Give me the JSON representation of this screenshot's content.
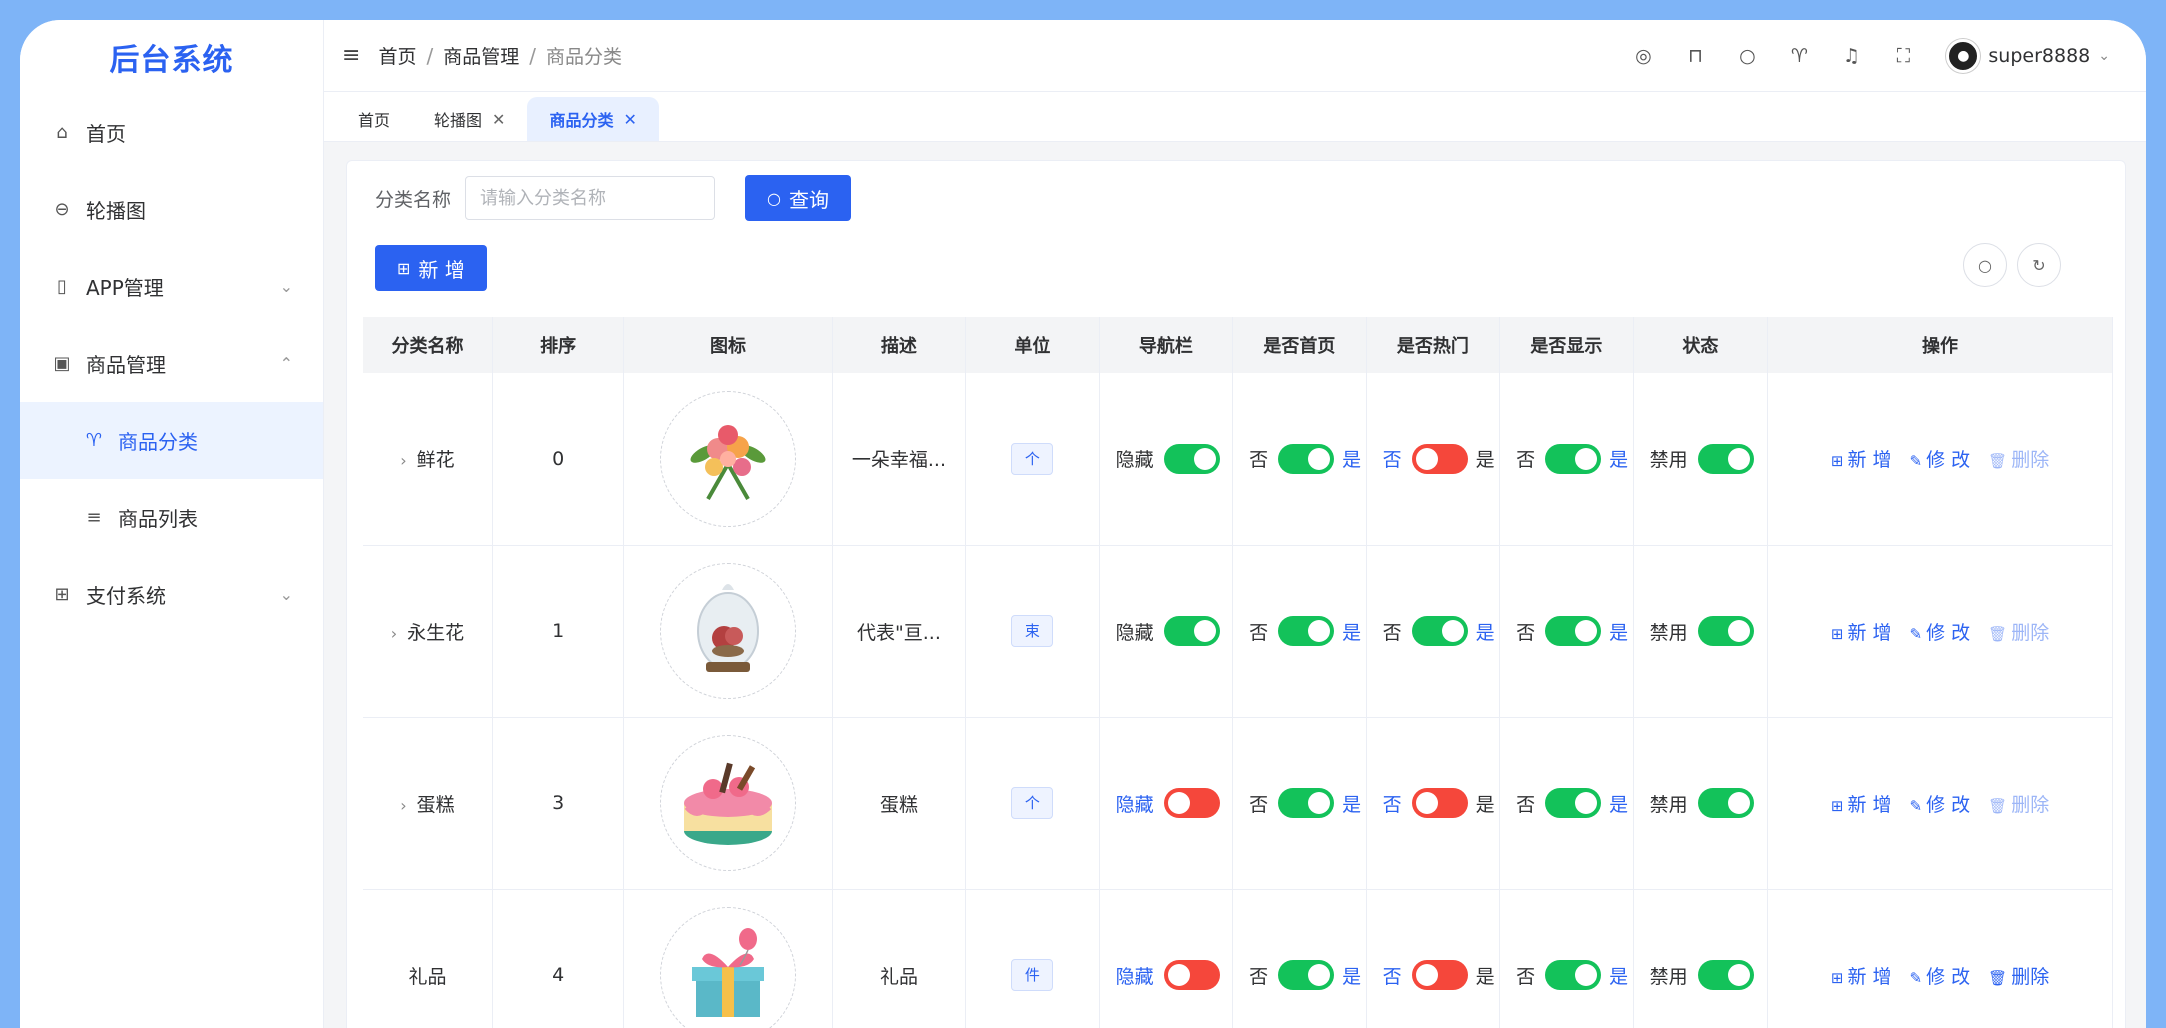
{
  "sidebar": {
    "logo": "后台系统",
    "items": [
      {
        "label": "首页",
        "icon": "home-icon"
      },
      {
        "label": "轮播图",
        "icon": "carousel-icon"
      },
      {
        "label": "APP管理",
        "icon": "phone-icon"
      },
      {
        "label": "商品管理",
        "icon": "product-icon"
      },
      {
        "label": "商品分类",
        "icon": "tshirt-icon"
      },
      {
        "label": "商品列表",
        "icon": "list-icon"
      },
      {
        "label": "支付系统",
        "icon": "payment-icon"
      }
    ]
  },
  "header": {
    "breadcrumb": [
      "首页",
      "商品管理",
      "商品分类"
    ],
    "username": "super8888"
  },
  "tabs": [
    {
      "label": "首页"
    },
    {
      "label": "轮播图"
    },
    {
      "label": "商品分类"
    }
  ],
  "search": {
    "label": "分类名称",
    "placeholder": "请输入分类名称",
    "button": "查询"
  },
  "toolbar": {
    "add_label": "新 增"
  },
  "table": {
    "columns": [
      "分类名称",
      "排序",
      "图标",
      "描述",
      "单位",
      "导航栏",
      "是否首页",
      "是否热门",
      "是否显示",
      "状态",
      "操作"
    ],
    "rows": [
      {
        "name": "鲜花",
        "sort": "0",
        "desc": "一朵幸福...",
        "unit": "个",
        "expandable": true,
        "nav": {
          "text": "隐藏",
          "on": true
        },
        "home": {
          "on": true
        },
        "hot": {
          "on": false
        },
        "show": {
          "on": true
        },
        "status": {
          "text": "禁用",
          "on": true
        }
      },
      {
        "name": "永生花",
        "sort": "1",
        "desc": "代表\"亘...",
        "unit": "束",
        "expandable": true,
        "nav": {
          "text": "隐藏",
          "on": true
        },
        "home": {
          "on": true
        },
        "hot": {
          "on": true
        },
        "show": {
          "on": true
        },
        "status": {
          "text": "禁用",
          "on": true
        }
      },
      {
        "name": "蛋糕",
        "sort": "3",
        "desc": "蛋糕",
        "unit": "个",
        "expandable": true,
        "nav": {
          "text": "隐藏",
          "on": false
        },
        "home": {
          "on": true
        },
        "hot": {
          "on": false
        },
        "show": {
          "on": true
        },
        "status": {
          "text": "禁用",
          "on": true
        }
      },
      {
        "name": "礼品",
        "sort": "4",
        "desc": "礼品",
        "unit": "件",
        "expandable": false,
        "nav": {
          "text": "隐藏",
          "on": false
        },
        "home": {
          "on": true
        },
        "hot": {
          "on": false
        },
        "show": {
          "on": true
        },
        "status": {
          "text": "禁用",
          "on": true
        }
      }
    ],
    "switch_off_text": "否",
    "switch_on_text": "是",
    "ops": {
      "add": "新 增",
      "edit": "修 改",
      "delete": "删除"
    }
  },
  "colors": {
    "primary": "#2b62f1",
    "switch_on": "#13c25a",
    "switch_off": "#f5473b",
    "backdrop": "#7eb4f7"
  }
}
